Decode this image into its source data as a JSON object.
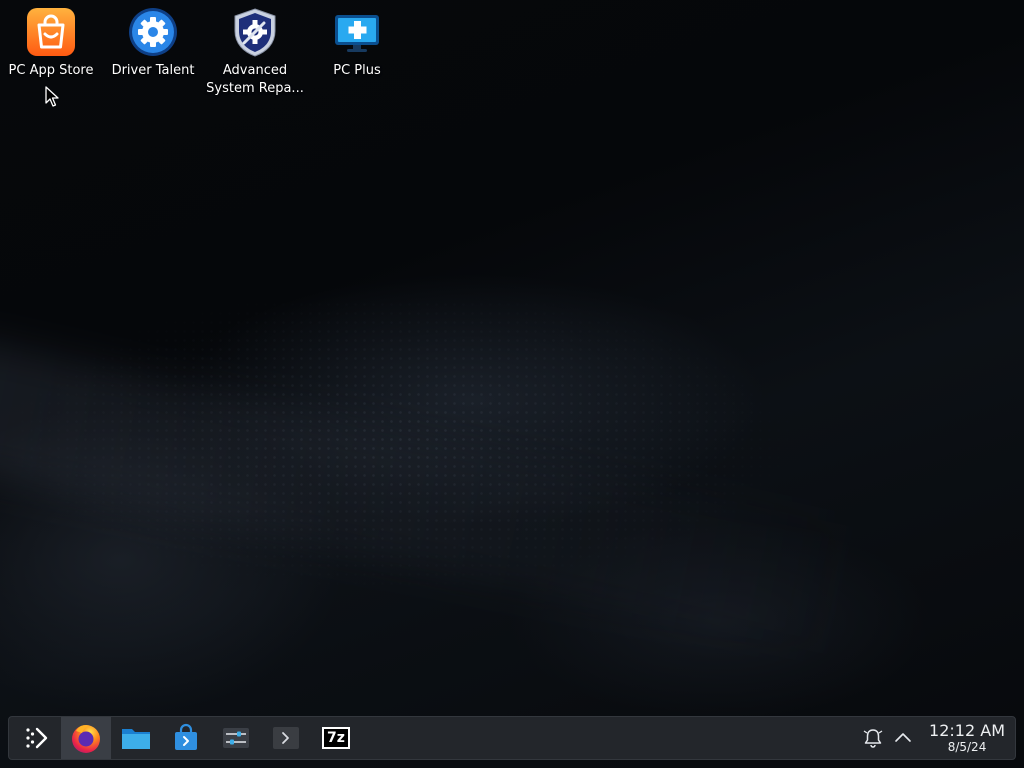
{
  "desktop": {
    "icons": [
      {
        "label": "PC App Store",
        "icon": "shopping-bag-icon",
        "color": "#ff7a1a"
      },
      {
        "label": "Driver Talent",
        "icon": "gear-icon",
        "color": "#1f6fd1"
      },
      {
        "label": "Advanced\nSystem Repa...",
        "icon": "shield-gear-icon",
        "color": "#2b3d8f"
      },
      {
        "label": "PC Plus",
        "icon": "monitor-plus-icon",
        "color": "#1d9be6"
      }
    ]
  },
  "taskbar": {
    "apps": [
      {
        "name": "application-launcher",
        "icon": "launcher-icon"
      },
      {
        "name": "firefox",
        "icon": "firefox-icon",
        "active": true
      },
      {
        "name": "file-manager",
        "icon": "folder-icon"
      },
      {
        "name": "discover-store",
        "icon": "store-bag-icon"
      },
      {
        "name": "system-settings",
        "icon": "sliders-icon"
      },
      {
        "name": "terminal",
        "icon": "terminal-icon"
      },
      {
        "name": "7zip",
        "icon": "7z-icon",
        "text": "7z"
      }
    ],
    "tray": {
      "notifications_icon": "bell-icon",
      "expand_icon": "chevron-up-icon"
    },
    "clock": {
      "time": "12:12 AM",
      "date": "8/5/24"
    }
  }
}
